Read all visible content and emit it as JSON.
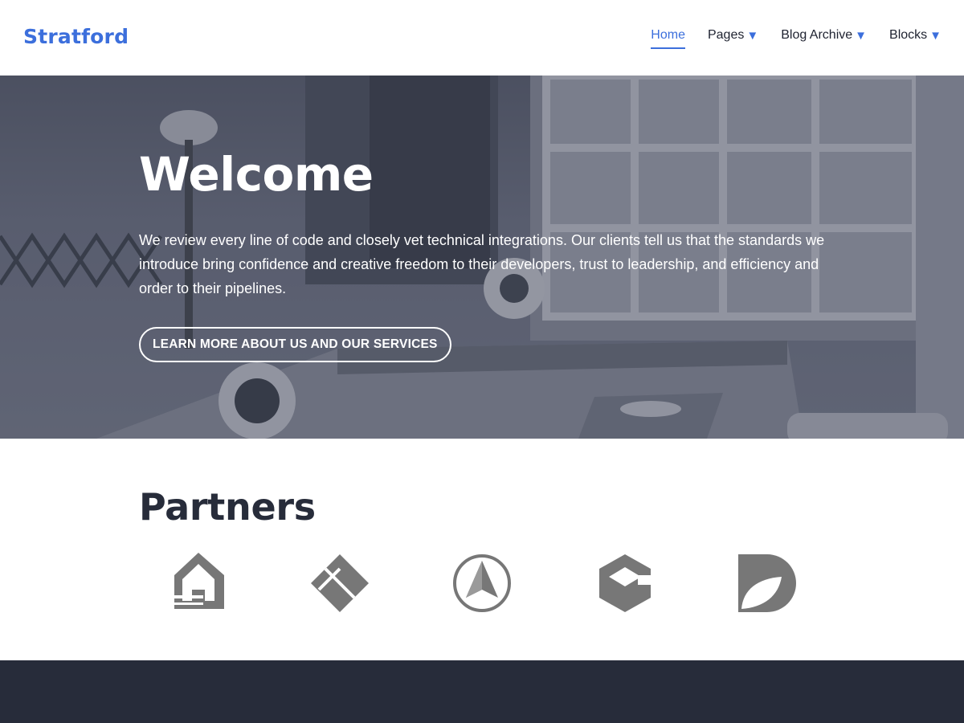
{
  "site": {
    "title": "Stratford"
  },
  "nav": {
    "items": [
      {
        "label": "Home",
        "active": true,
        "has_dropdown": false
      },
      {
        "label": "Pages",
        "active": false,
        "has_dropdown": true
      },
      {
        "label": "Blog Archive",
        "active": false,
        "has_dropdown": true
      },
      {
        "label": "Blocks",
        "active": false,
        "has_dropdown": true
      }
    ],
    "dropdown_glyph": "▼"
  },
  "hero": {
    "title": "Welcome",
    "text": "We review every line of code and closely vet technical integrations. Our clients tell us that the standards we introduce bring confidence and creative freedom to their developers, trust to leadership, and efficiency and order to their pipelines.",
    "button_label": "LEARN MORE ABOUT US AND OUR SERVICES"
  },
  "partners": {
    "title": "Partners",
    "logos": [
      {
        "icon": "house-logo-icon"
      },
      {
        "icon": "diamond-logo-icon"
      },
      {
        "icon": "compass-arrow-logo-icon"
      },
      {
        "icon": "hexagon-logo-icon"
      },
      {
        "icon": "leaf-d-logo-icon"
      }
    ]
  },
  "colors": {
    "accent": "#3c6fdc",
    "dark": "#272c3a",
    "logo_gray": "#777777"
  }
}
